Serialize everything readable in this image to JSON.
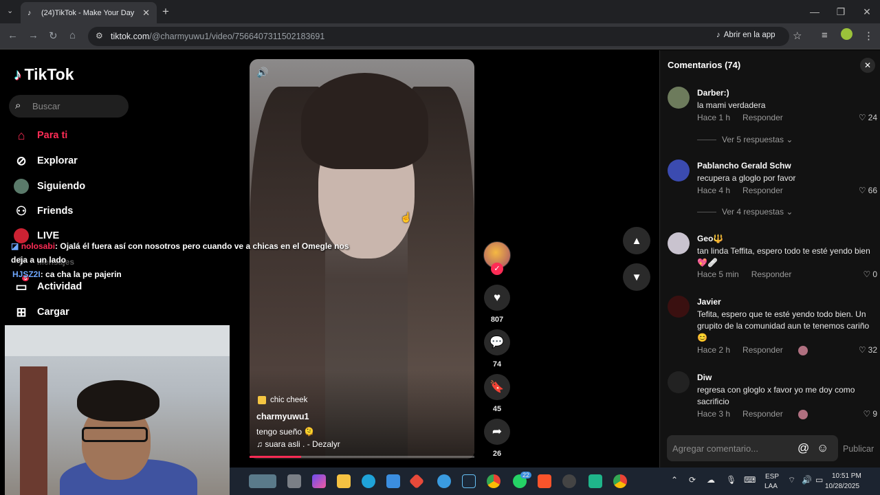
{
  "browser": {
    "tab_title": "(24)TikTok - Make Your Day",
    "url_host": "tiktok.com",
    "url_path": "/@charmyuwu1/video/7566407311502183691",
    "open_in_app": "Abrir en la app"
  },
  "sidebar": {
    "logo": "TikTok",
    "search_placeholder": "Buscar",
    "items": [
      {
        "label": "Para ti"
      },
      {
        "label": "Explorar"
      },
      {
        "label": "Siguiendo"
      },
      {
        "label": "Friends"
      },
      {
        "label": "LIVE"
      },
      {
        "label": "Mensajes"
      },
      {
        "label": "Actividad"
      },
      {
        "label": "Cargar"
      }
    ],
    "activity_badge": "5"
  },
  "overlay_chat": [
    {
      "user": "nolosabi",
      "text": ": Ojalá él fuera así con nosotros pero cuando ve a chicas en el Omegle nos deja a un lado"
    },
    {
      "user": "HJSZ2I",
      "text": ": ca cha la pe pajerin"
    }
  ],
  "video": {
    "sticker": "chic cheek",
    "author": "charmyuwu1",
    "description": "tengo sueño 🫠",
    "music": "♫  suara asli . - Dezalyr",
    "progress": 0.23
  },
  "actions": {
    "likes": "807",
    "comments": "74",
    "saves": "45",
    "shares": "26"
  },
  "comments": {
    "title": "Comentarios (74)",
    "list": [
      {
        "name": "Darber:)",
        "text": "la mami verdadera",
        "time": "Hace 1 h",
        "reply": "Responder",
        "likes": "24",
        "replies": "Ver 5 respuestas"
      },
      {
        "name": "Pablancho Gerald Schw",
        "text": "recupera a gloglo por favor",
        "time": "Hace 4 h",
        "reply": "Responder",
        "likes": "66",
        "replies": "Ver 4 respuestas"
      },
      {
        "name": "Geo🔱",
        "text": "tan linda Teffita, espero todo te esté yendo bien 💖🩹",
        "time": "Hace 5 min",
        "reply": "Responder",
        "likes": "0"
      },
      {
        "name": "Javier",
        "text": "Tefita, espero que te esté yendo todo bien. Un grupito de la comunidad aun te tenemos cariño 😊",
        "time": "Hace 2 h",
        "reply": "Responder",
        "likes": "32"
      },
      {
        "name": "Diw",
        "text": "regresa con gloglo x favor yo me doy como sacrificio",
        "time": "Hace 3 h",
        "reply": "Responder",
        "likes": "9"
      }
    ],
    "input_placeholder": "Agregar comentario...",
    "publish": "Publicar"
  },
  "taskbar": {
    "lang_top": "ESP",
    "lang_bottom": "LAA",
    "time": "10:51 PM",
    "date": "10/28/2025",
    "whatsapp_badge": "22"
  },
  "colors": {
    "accent": "#fe2c55",
    "panel": "#121212",
    "bg": "#000000"
  }
}
